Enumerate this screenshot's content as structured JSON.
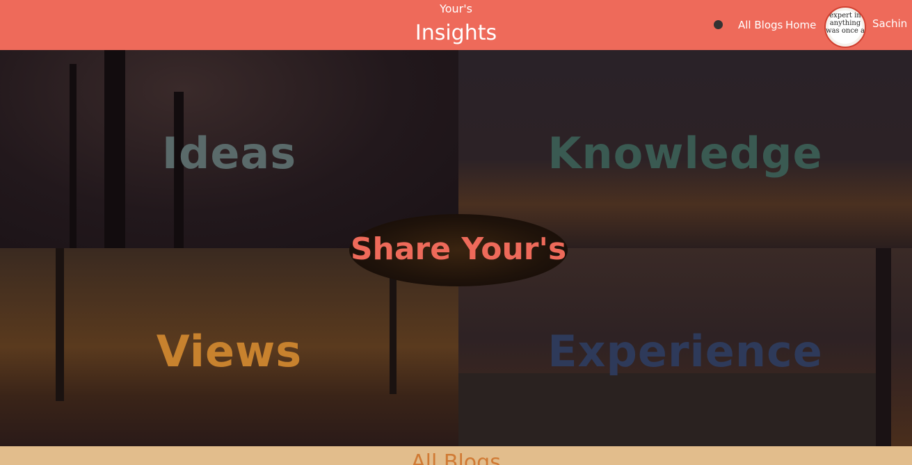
{
  "header": {
    "brand_top": "Your's",
    "brand_main": "Insights",
    "nav": {
      "all_blogs": "All Blogs",
      "home": "Home"
    },
    "avatar_text": "expert in anything was once a",
    "username": "Sachin"
  },
  "panels": [
    "Ideas",
    "Knowledge",
    "Views",
    "Experience"
  ],
  "center_label": "Share Your's",
  "footer": {
    "title": "All Blogs"
  },
  "colors": {
    "header": "#ee6a5a",
    "footer": "#e2bd8c",
    "accent": "#ee6a5a"
  },
  "icons": {
    "theme_toggle": "dot-icon"
  }
}
